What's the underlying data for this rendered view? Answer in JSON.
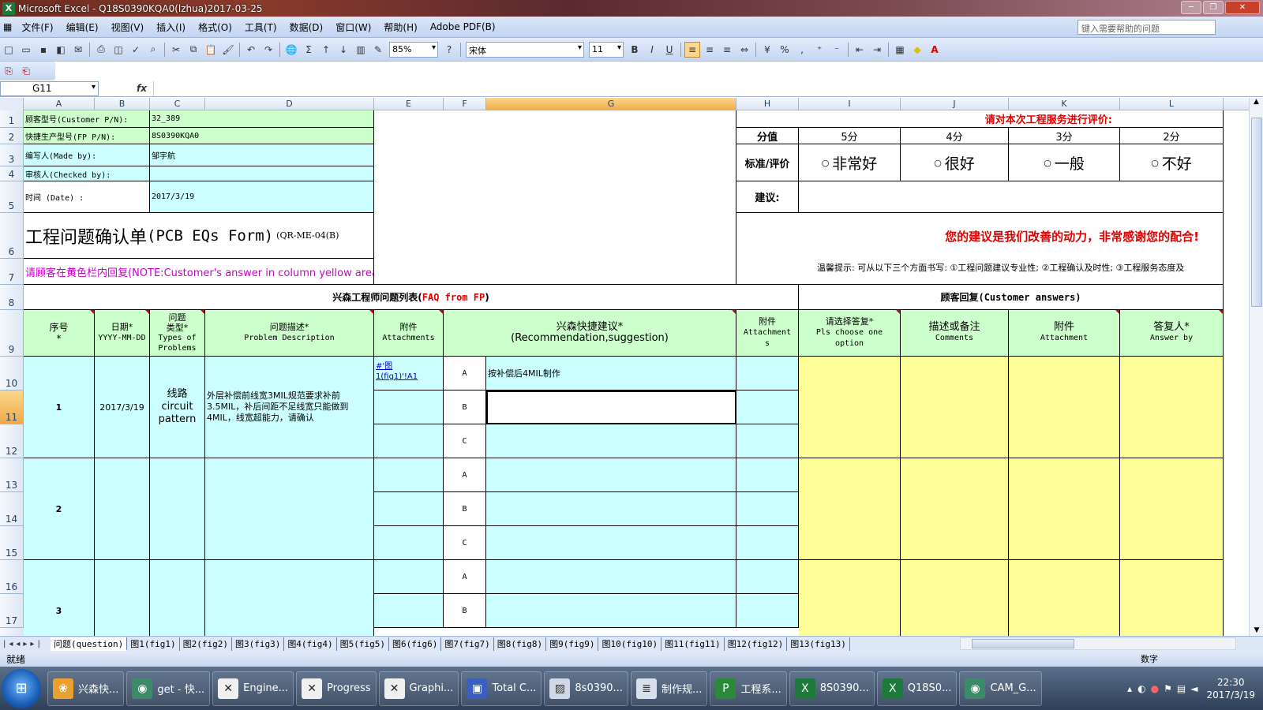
{
  "window": {
    "title": "Microsoft Excel - Q18S0390KQA0(lzhua)2017-03-25"
  },
  "menu": [
    "文件(F)",
    "编辑(E)",
    "视图(V)",
    "插入(I)",
    "格式(O)",
    "工具(T)",
    "数据(D)",
    "窗口(W)",
    "帮助(H)",
    "Adobe PDF(B)"
  ],
  "help_placeholder": "键入需要帮助的问题",
  "toolbar": {
    "zoom": "85%",
    "font": "宋体",
    "size": "11",
    "bold": "B",
    "italic": "I",
    "underline": "U",
    "percent": "%",
    "comma": ",",
    "sigma": "Σ"
  },
  "namebox": "G11",
  "fx": "fx",
  "columns": [
    "A",
    "B",
    "C",
    "D",
    "E",
    "F",
    "G",
    "H",
    "I",
    "J",
    "K",
    "L"
  ],
  "rows": [
    "1",
    "2",
    "3",
    "4",
    "5",
    "6",
    "7",
    "8",
    "9",
    "10",
    "11",
    "12",
    "13",
    "14",
    "15",
    "16",
    "17"
  ],
  "header": {
    "r1_label": "顾客型号(Customer P/N):",
    "r1_value": "32_389",
    "r2_label": "快捷生产型号(FP P/N):",
    "r2_value": "8S0390KQA0",
    "r3_label": "编写人(Made by):",
    "r3_value": "邹宇航",
    "r4_label": "审核人(Checked by):",
    "r4_value": "",
    "r5_label": "时间 (Date) :",
    "r5_value": "2017/3/19",
    "form_title": "工程问题确认单",
    "form_title_en": "(PCB EQs Form)",
    "form_code": "(QR-ME-04(B)",
    "note": "请顾客在黄色栏内回复(NOTE:Customer's answer in column yellow area)"
  },
  "rating": {
    "title": "请对本次工程服务进行评价:",
    "score_label": "分值",
    "scores": [
      "5分",
      "4分",
      "3分",
      "2分"
    ],
    "standard_label": "标准/评价",
    "options": [
      "非常好",
      "很好",
      "一般",
      "不好"
    ],
    "suggest_label": "建议:",
    "thanks": "您的建议是我们改善的动力，非常感谢您的配合!",
    "tip": "温馨提示: 可从以下三个方面书写: ①工程问题建议专业性; ②工程确认及时性; ③工程服务态度及"
  },
  "section": {
    "fp_list": "兴森工程师问题列表(",
    "fp_list_en": "FAQ from FP",
    "fp_list_end": ")",
    "customer": "顾客回复(Customer answers)"
  },
  "table_headers": {
    "seq": [
      "序号",
      "*"
    ],
    "date": [
      "日期*",
      "YYYY-MM-DD"
    ],
    "type": [
      "问题",
      "类型*",
      "Types of",
      "Problems"
    ],
    "desc": [
      "问题描述*",
      "Problem Description"
    ],
    "attach": [
      "附件",
      "Attachments"
    ],
    "reco": [
      "兴森快捷建议*",
      "(Recommendation,suggestion)"
    ],
    "attach2": [
      "附件",
      "Attachment",
      "s"
    ],
    "option": [
      "请选择答复*",
      "Pls choose one option"
    ],
    "comments": [
      "描述或备注",
      "Comments"
    ],
    "attach3": [
      "附件",
      "Attachment"
    ],
    "answer": [
      "答复人*",
      "Answer by"
    ]
  },
  "issues": [
    {
      "no": "1",
      "date": "2017/3/19",
      "type": [
        "线路",
        "circuit",
        "pattern"
      ],
      "desc": "外层补偿前线宽3MIL规范要求补前3.5MIL，补后间距不足线宽只能做到4MIL，线宽超能力，请确认",
      "attach": [
        "#'图",
        "1(fig1)'!A1"
      ],
      "opts": [
        "A",
        "B",
        "C"
      ],
      "reco": [
        "按补偿后4MIL制作",
        "",
        ""
      ]
    },
    {
      "no": "2",
      "date": "",
      "type": [],
      "desc": "",
      "attach": [],
      "opts": [
        "A",
        "B",
        "C"
      ],
      "reco": [
        "",
        "",
        ""
      ]
    },
    {
      "no": "3",
      "date": "",
      "type": [],
      "desc": "",
      "attach": [],
      "opts": [
        "A",
        "B"
      ],
      "reco": [
        "",
        ""
      ]
    }
  ],
  "sheet_tabs": [
    "问题(question)",
    "图1(fig1)",
    "图2(fig2)",
    "图3(fig3)",
    "图4(fig4)",
    "图5(fig5)",
    "图6(fig6)",
    "图7(fig7)",
    "图8(fig8)",
    "图9(fig9)",
    "图10(fig10)",
    "图11(fig11)",
    "图12(fig12)",
    "图13(fig13)"
  ],
  "status": {
    "ready": "就绪",
    "mode": "数字"
  },
  "taskbar": {
    "items": [
      {
        "label": "兴森快...",
        "icon": "shell-icon",
        "color": "#e8a030"
      },
      {
        "label": "get - 快...",
        "icon": "fish-icon",
        "color": "#3c8a6a"
      },
      {
        "label": "Engine...",
        "icon": "x-icon",
        "color": "#f0f0f0"
      },
      {
        "label": "Progress",
        "icon": "x-icon",
        "color": "#f0f0f0"
      },
      {
        "label": "Graphi...",
        "icon": "x-icon",
        "color": "#f0f0f0"
      },
      {
        "label": "Total C...",
        "icon": "disk-icon",
        "color": "#3a5fc0"
      },
      {
        "label": "8s0390...",
        "icon": "image-icon",
        "color": "#d0d8e8"
      },
      {
        "label": "制作规...",
        "icon": "doc-icon",
        "color": "#d8e0ee"
      },
      {
        "label": "工程系...",
        "icon": "p-icon",
        "color": "#2a8a3a"
      },
      {
        "label": "8S0390...",
        "icon": "excel-icon",
        "color": "#1e7a3a"
      },
      {
        "label": "Q18S0...",
        "icon": "excel-icon",
        "color": "#1e7a3a"
      },
      {
        "label": "CAM_G...",
        "icon": "fish-icon",
        "color": "#3c8a6a"
      }
    ],
    "time": "22:30",
    "date": "2017/3/19"
  }
}
